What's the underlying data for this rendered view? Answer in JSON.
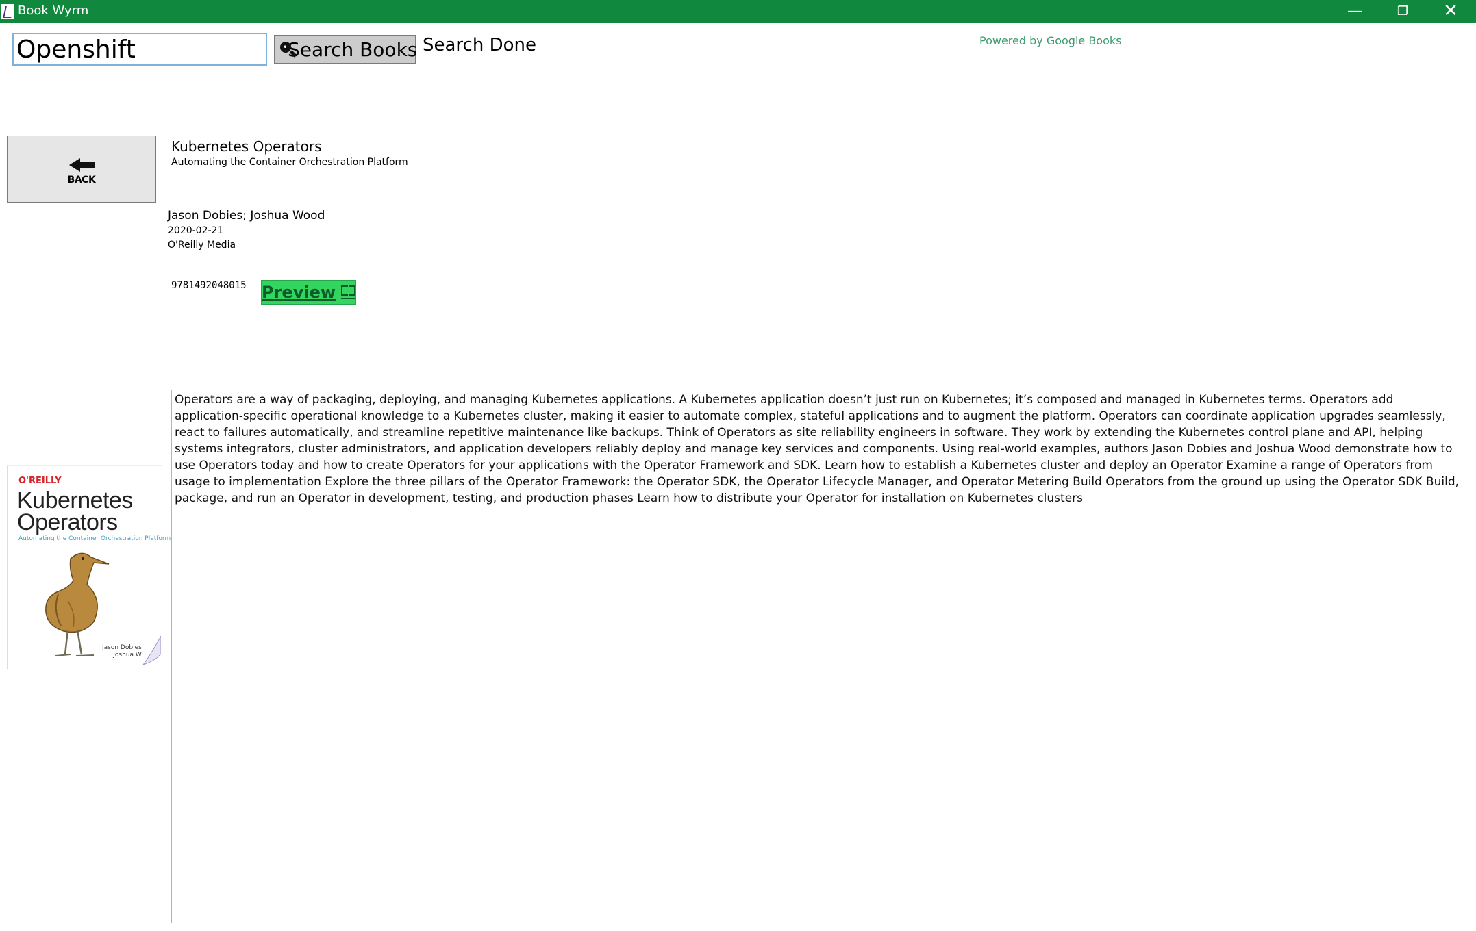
{
  "window": {
    "title": "Book Wyrm",
    "minimize_glyph": "—",
    "maximize_glyph": "❐",
    "close_glyph": "✕"
  },
  "search": {
    "value": "Openshift",
    "button_label": "Search Books",
    "status": "Search Done",
    "attribution": "Powered by Google Books"
  },
  "back_button": {
    "label": "BACK"
  },
  "book": {
    "title": "Kubernetes Operators",
    "subtitle": "Automating the Container Orchestration Platform",
    "authors": "Jason Dobies; Joshua Wood",
    "published_date": "2020-02-21",
    "publisher": "O'Reilly Media",
    "isbn": "9781492048015",
    "preview_label": "Preview",
    "description": "Operators are a way of packaging, deploying, and managing Kubernetes applications. A Kubernetes application doesn’t just run on Kubernetes; it’s composed and managed in Kubernetes terms. Operators add application-specific operational knowledge to a Kubernetes cluster, making it easier to automate complex, stateful applications and to augment the platform. Operators can coordinate application upgrades seamlessly, react to failures automatically, and streamline repetitive maintenance like backups. Think of Operators as site reliability engineers in software. They work by extending the Kubernetes control plane and API, helping systems integrators, cluster administrators, and application developers reliably deploy and manage key services and components. Using real-world examples, authors Jason Dobies and Joshua Wood demonstrate how to use Operators today and how to create Operators for your applications with the Operator Framework and SDK. Learn how to establish a Kubernetes cluster and deploy an Operator Examine a range of Operators from usage to implementation Explore the three pillars of the Operator Framework: the Operator SDK, the Operator Lifecycle Manager, and Operator Metering Build Operators from the ground up using the Operator SDK Build, package, and run an Operator in development, testing, and production phases Learn how to distribute your Operator for installation on Kubernetes clusters"
  },
  "cover": {
    "publisher": "O'REILLY",
    "title_line1": "Kubernetes",
    "title_line2": "Operators",
    "subtitle": "Automating the Container Orchestration Platform",
    "author1": "Jason Dobies",
    "author2": "Joshua W"
  },
  "colors": {
    "titlebar": "#10893e",
    "preview_button": "#33d55e",
    "attribution": "#3c9a6e",
    "input_border": "#7fb2d9"
  },
  "icons": {
    "app": "app-icon",
    "search": "search-icon",
    "back": "arrow-left-icon",
    "preview": "book-icon"
  }
}
